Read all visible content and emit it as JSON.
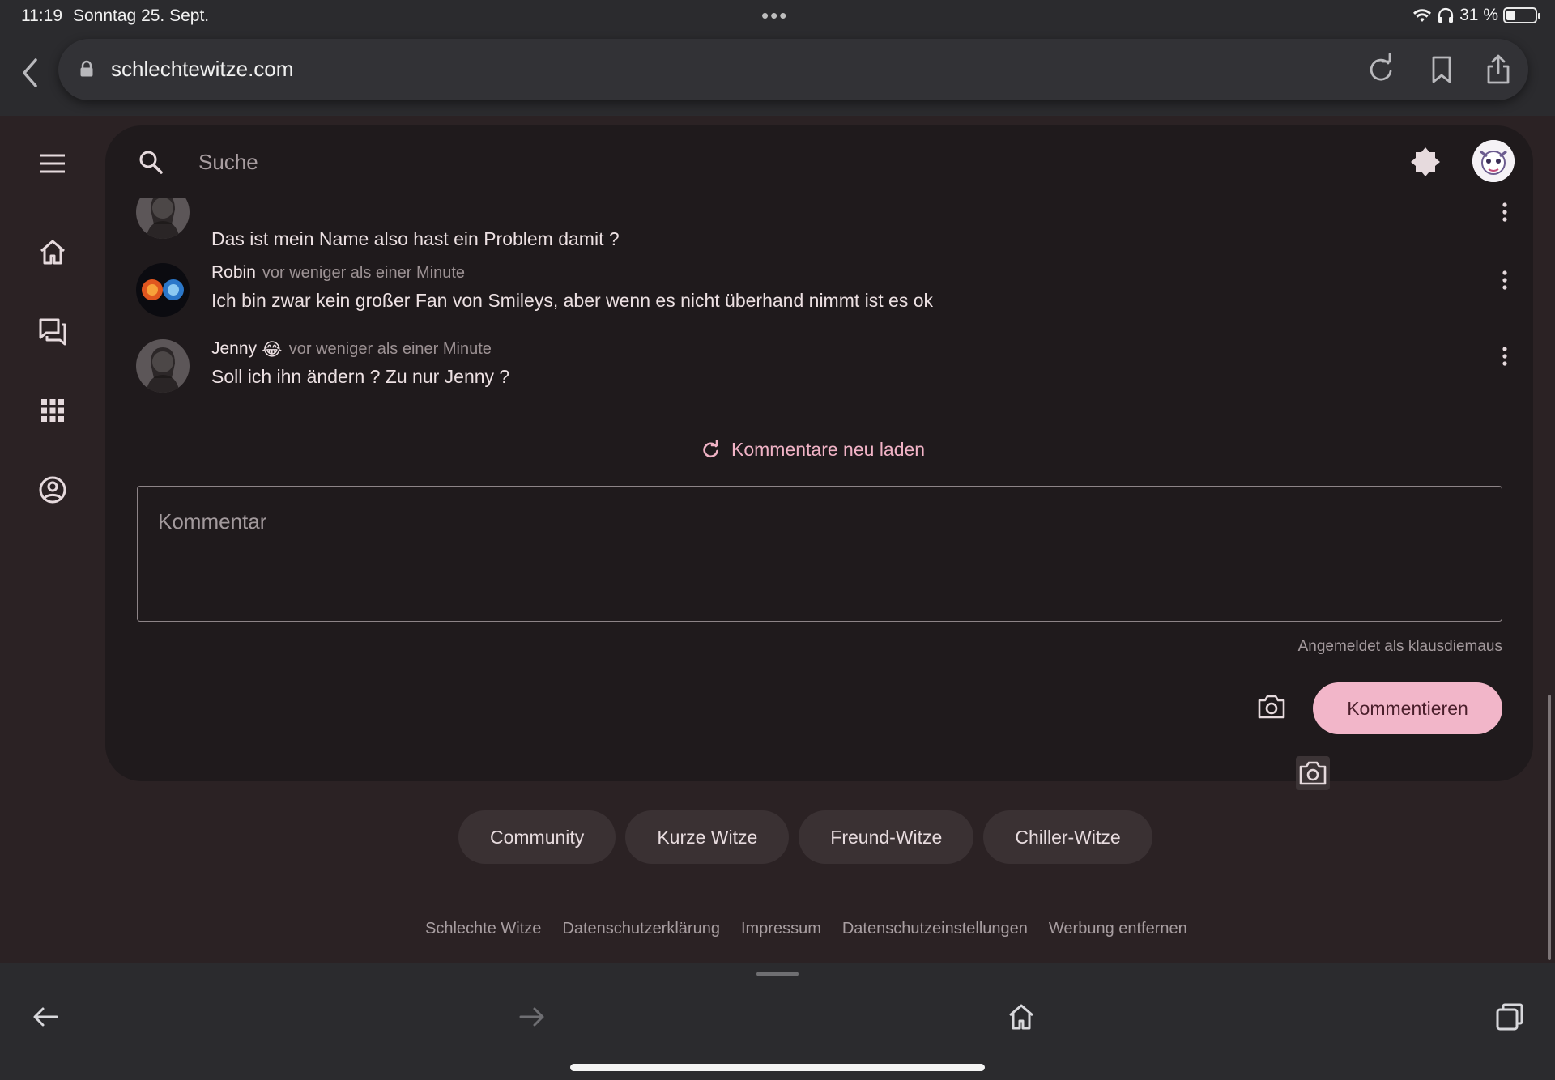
{
  "status_bar": {
    "time": "11:19",
    "date": "Sonntag 25. Sept.",
    "dots": "•••",
    "battery_text": "31 %",
    "battery_level": 0.31
  },
  "browser": {
    "url": "schlechtewitze.com",
    "icons": [
      "back-icon",
      "lock-icon",
      "reload-icon",
      "bookmark-icon",
      "share-icon"
    ]
  },
  "site": {
    "search": {
      "placeholder": "Suche"
    },
    "rail": [
      "menu-icon",
      "home-icon",
      "forum-icon",
      "apps-icon",
      "account-icon"
    ],
    "comments": [
      {
        "author": "",
        "time": "",
        "emoji": "",
        "text": "Das ist mein Name also hast ein Problem damit ?"
      },
      {
        "author": "Robin",
        "time": "vor weniger als einer Minute",
        "emoji": "",
        "text": "Ich bin zwar kein großer Fan von Smileys, aber wenn es nicht überhand nimmt ist es ok"
      },
      {
        "author": "Jenny",
        "time": "vor weniger als einer Minute",
        "emoji": "😂",
        "text": "Soll ich ihn ändern ? Zu nur Jenny ?"
      }
    ],
    "reload_label": "Kommentare neu laden",
    "comment_field": {
      "placeholder": "Kommentar",
      "value": ""
    },
    "signed_in": "Angemeldet als klausdiemaus",
    "submit_label": "Kommentieren",
    "chips": [
      "Community",
      "Kurze Witze",
      "Freund-Witze",
      "Chiller-Witze"
    ],
    "footer": [
      "Schlechte Witze",
      "Datenschutzerklärung",
      "Impressum",
      "Datenschutzeinstellungen",
      "Werbung entfernen"
    ]
  },
  "colors": {
    "accent": "#f2b6c9",
    "surface": "#1f1a1c",
    "background": "#2b2224"
  }
}
